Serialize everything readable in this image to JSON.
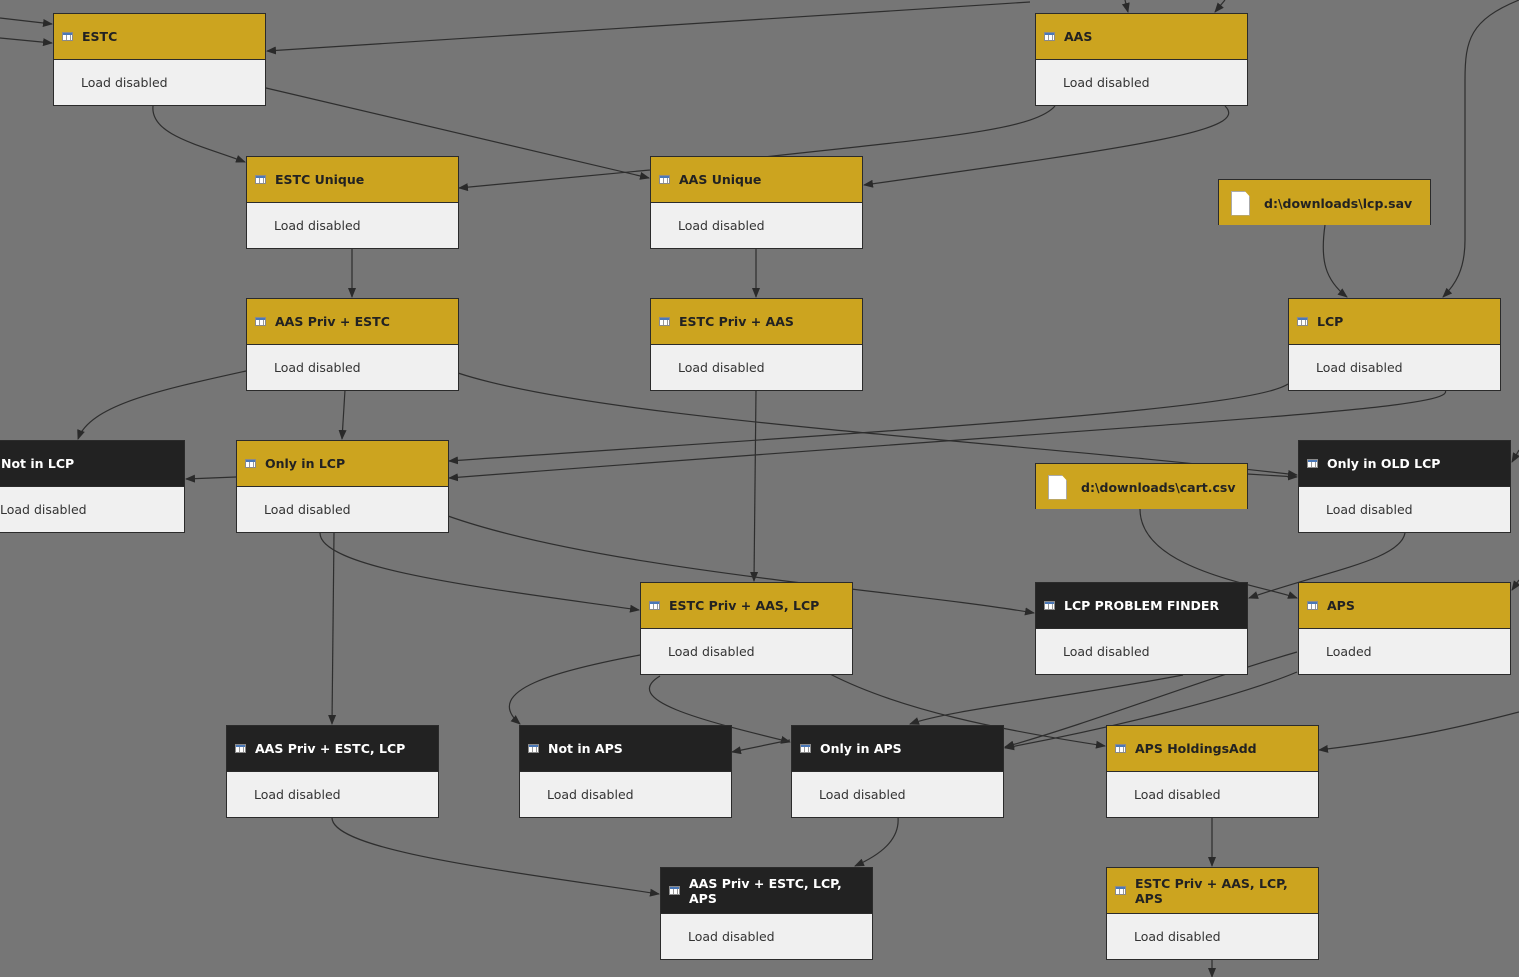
{
  "colors": {
    "background": "#767676",
    "query_header": "#cca41f",
    "highlighted_header": "#222222",
    "body": "#f0f0f0"
  },
  "nodes": [
    {
      "title": "ESTC",
      "status": "Load disabled",
      "style": "gold",
      "icon": "table-icon"
    },
    {
      "title": "AAS",
      "status": "Load disabled",
      "style": "gold",
      "icon": "table-icon"
    },
    {
      "title": "ESTC Unique",
      "status": "Load disabled",
      "style": "gold",
      "icon": "table-icon"
    },
    {
      "title": "AAS Unique",
      "status": "Load disabled",
      "style": "gold",
      "icon": "table-icon"
    },
    {
      "title": "d:\\downloads\\lcp.sav",
      "style": "file",
      "icon": "file-icon"
    },
    {
      "title": "AAS Priv + ESTC",
      "status": "Load disabled",
      "style": "gold",
      "icon": "table-icon"
    },
    {
      "title": "ESTC Priv + AAS",
      "status": "Load disabled",
      "style": "gold",
      "icon": "table-icon"
    },
    {
      "title": "LCP",
      "status": "Load disabled",
      "style": "gold",
      "icon": "table-icon"
    },
    {
      "title": "Not in LCP",
      "status": "Load disabled",
      "style": "dark",
      "icon": "table-icon"
    },
    {
      "title": "Only in LCP",
      "status": "Load disabled",
      "style": "gold",
      "icon": "table-icon"
    },
    {
      "title": "d:\\downloads\\cart.csv",
      "style": "file",
      "icon": "file-icon"
    },
    {
      "title": "Only in OLD LCP",
      "status": "Load disabled",
      "style": "dark",
      "icon": "table-icon"
    },
    {
      "title": "ESTC Priv + AAS, LCP",
      "status": "Load disabled",
      "style": "gold",
      "icon": "table-icon"
    },
    {
      "title": "LCP PROBLEM FINDER",
      "status": "Load disabled",
      "style": "dark",
      "icon": "table-icon"
    },
    {
      "title": "APS",
      "status": "Loaded",
      "style": "gold",
      "icon": "table-icon"
    },
    {
      "title": "AAS Priv + ESTC, LCP",
      "status": "Load disabled",
      "style": "dark",
      "icon": "table-icon"
    },
    {
      "title": "Not in APS",
      "status": "Load disabled",
      "style": "dark",
      "icon": "table-icon"
    },
    {
      "title": "Only in APS",
      "status": "Load disabled",
      "style": "dark",
      "icon": "table-icon"
    },
    {
      "title": "APS HoldingsAdd",
      "status": "Load disabled",
      "style": "gold",
      "icon": "table-icon"
    },
    {
      "title": "AAS Priv + ESTC, LCP, APS",
      "status": "Load disabled",
      "style": "dark",
      "icon": "table-icon"
    },
    {
      "title": "ESTC Priv + AAS, LCP, APS",
      "status": "Load disabled",
      "style": "gold",
      "icon": "table-icon"
    }
  ]
}
